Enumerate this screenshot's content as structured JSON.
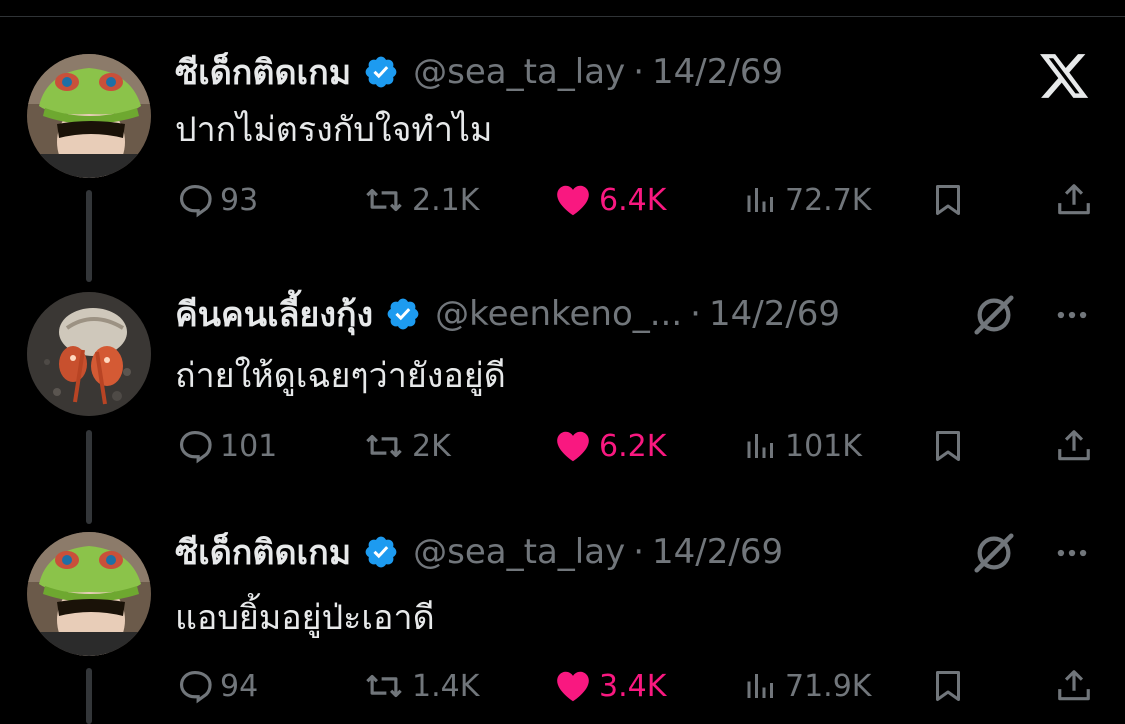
{
  "thread": [
    {
      "display_name": "ซีเด็กติดเกม",
      "handle": "@sea_ta_lay",
      "separator": "·",
      "date": "14/2/69",
      "text": "ปากไม่ตรงกับใจทำไม",
      "replies": "93",
      "reposts": "2.1K",
      "likes": "6.4K",
      "views": "72.7K",
      "top_right_icon": "x-logo-icon"
    },
    {
      "display_name": "คีนคนเลี้ยงกุ้ง",
      "handle": "@keenkeno_...",
      "separator": "·",
      "date": "14/2/69",
      "text": "ถ่ายให้ดูเฉยๆว่ายังอยู่ดี",
      "replies": "101",
      "reposts": "2K",
      "likes": "6.2K",
      "views": "101K",
      "top_right_icon": "grok-icon"
    },
    {
      "display_name": "ซีเด็กติดเกม",
      "handle": "@sea_ta_lay",
      "separator": "·",
      "date": "14/2/69",
      "text": "แอบยิ้มอยู่ป่ะเอาดี",
      "replies": "94",
      "reposts": "1.4K",
      "likes": "3.4K",
      "views": "71.9K",
      "top_right_icon": "grok-icon"
    }
  ],
  "colors": {
    "background": "#000000",
    "text": "#e7e9ea",
    "muted": "#71767b",
    "like": "#f91880",
    "verified": "#1d9bf0",
    "thread_line": "#333639"
  }
}
